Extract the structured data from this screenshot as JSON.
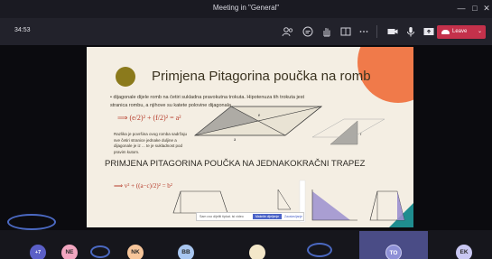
{
  "window": {
    "title": "Meeting in \"General\"",
    "minimize_glyph": "—",
    "maximize_glyph": "□",
    "close_glyph": "✕"
  },
  "toolbar": {
    "timer": "34:53",
    "icons": [
      "participants-icon",
      "chat-icon",
      "raise-hand-icon",
      "rooms-icon",
      "more-options-icon",
      "camera-icon",
      "mic-icon",
      "share-icon"
    ],
    "leave_label": "Leave",
    "leave_caret": "⌄",
    "leave_color": "#c4314b"
  },
  "slide": {
    "title": "Primjena Pitagorina poučka na romb",
    "bullet": "• dijagonale dijele romb na četiri sukladna pravokutna trokuta. Hipotenuza tih trokuta jest stranica rombu, a njihove su katete polovine dijagonala",
    "formula1": "⟹ (e/2)² + (f/2)² = a²",
    "note": "Razlika je površina ovog romba sadržaju sve četiri stranice jednake duljine a dijagonale je iz ... te je sukladnost pod pravim kutom.",
    "subtitle": "PRIMJENA PITAGORINA POUČKA NA JEDNAKOKRAČNI TRAPEZ",
    "formula2": "⟹  v² + ((a−c)/2)² = b²",
    "label_e": "e",
    "label_a": "a",
    "label_f": "f",
    "colors": {
      "orange": "#f07a4a",
      "teal": "#1f8d8f",
      "olive": "#8b7a1c",
      "accent": "#b53b2a"
    }
  },
  "popup": {
    "text": "Sam uvo dijeliti tipkat. isi video",
    "primary": "Maknite dijeljenje",
    "secondary": "Zaustavljanje"
  },
  "participants": [
    {
      "initials": "+7",
      "color": "#5b5fc7"
    },
    {
      "initials": "NE",
      "color": "#f2a6c0"
    },
    {
      "initials": "NK",
      "color": "#f6c59a"
    },
    {
      "initials": "BB",
      "color": "#a8c6f0"
    },
    {
      "initials": "",
      "color": "#f3e7c9"
    },
    {
      "initials": "TO",
      "color": "#8e90d6"
    },
    {
      "initials": "EK",
      "color": "#c9c7f2"
    }
  ]
}
